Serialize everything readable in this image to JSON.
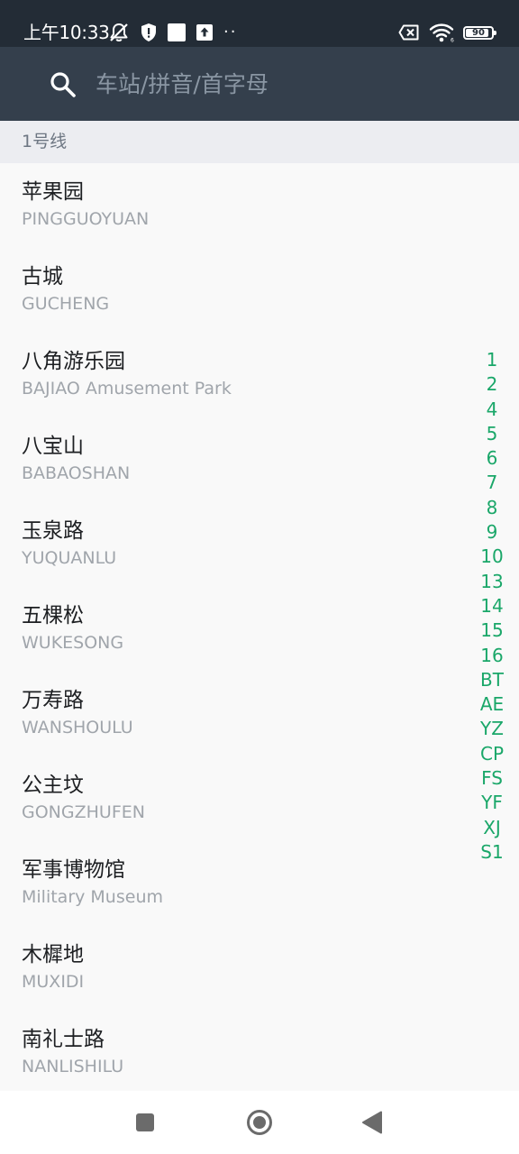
{
  "status_bar": {
    "time": "上午10:33",
    "more_dots": "··",
    "battery_level": "90",
    "battery_fraction": 0.9,
    "icons": [
      "bell-muted-icon",
      "shield-alert-icon",
      "square-notification-icon",
      "upload-icon",
      "sim-x-icon",
      "wifi-icon",
      "battery-icon"
    ]
  },
  "search": {
    "placeholder": "车站/拼音/首字母",
    "value": "",
    "icon": "search-icon"
  },
  "section": {
    "title": "1号线"
  },
  "stations": [
    {
      "name": "苹果园",
      "pinyin": "PINGGUOYUAN"
    },
    {
      "name": "古城",
      "pinyin": "GUCHENG"
    },
    {
      "name": "八角游乐园",
      "pinyin": "BAJIAO Amusement Park"
    },
    {
      "name": "八宝山",
      "pinyin": "BABAOSHAN"
    },
    {
      "name": "玉泉路",
      "pinyin": "YUQUANLU"
    },
    {
      "name": "五棵松",
      "pinyin": "WUKESONG"
    },
    {
      "name": "万寿路",
      "pinyin": "WANSHOULU"
    },
    {
      "name": "公主坟",
      "pinyin": "GONGZHUFEN"
    },
    {
      "name": "军事博物馆",
      "pinyin": "Military Museum"
    },
    {
      "name": "木樨地",
      "pinyin": "MUXIDI"
    },
    {
      "name": "南礼士路",
      "pinyin": "NANLISHILU"
    }
  ],
  "line_index": [
    "1",
    "2",
    "4",
    "5",
    "6",
    "7",
    "8",
    "9",
    "10",
    "13",
    "14",
    "15",
    "16",
    "BT",
    "AE",
    "YZ",
    "CP",
    "FS",
    "YF",
    "XJ",
    "S1"
  ],
  "colors": {
    "status_bar_bg": "#232c36",
    "header_bg": "#343f4c",
    "section_bg": "#ecedf1",
    "accent_green": "#1aa769"
  }
}
